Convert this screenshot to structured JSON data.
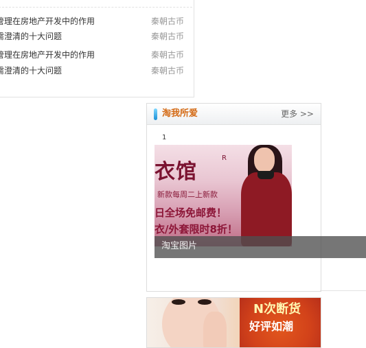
{
  "articles": [
    {
      "title": "管理在房地产开发中的作用",
      "source": "秦朝古币"
    },
    {
      "title": "需澄清的十大问题",
      "source": "秦朝古币"
    },
    {
      "title": "管理在房地产开发中的作用",
      "source": "秦朝古币"
    },
    {
      "title": "需澄清的十大问题",
      "source": "秦朝古币"
    }
  ],
  "favorites": {
    "title": "淘我所爱",
    "more_label": "更多 >>",
    "item_index": "1",
    "promo": {
      "logo": "衣馆",
      "registered": "R",
      "subtitle": "新款每周二上新款",
      "line1": "日全场免邮费！",
      "line2": "衣/外套限时8折！"
    },
    "caption": "淘宝图片"
  },
  "ad": {
    "line1": "N次断货",
    "line2": "好评如潮"
  },
  "colors": {
    "accent_orange": "#d46a15",
    "bar_blue": "#1b8fd6",
    "muted_text": "#999999",
    "caption_bg": "#505050"
  }
}
